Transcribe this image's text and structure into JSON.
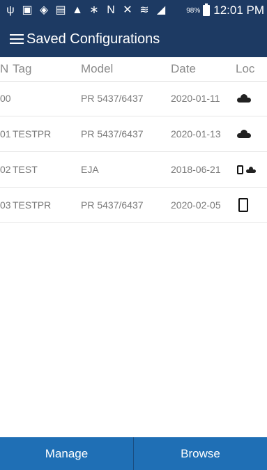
{
  "status_bar": {
    "icons": [
      "usb-icon",
      "image-icon",
      "shield-icon",
      "calendar-icon",
      "warning-icon",
      "bluetooth-icon",
      "nfc-icon",
      "mute-icon",
      "wifi-icon",
      "signal-icon"
    ],
    "battery_percent": "98%",
    "time": "12:01 PM"
  },
  "app_bar": {
    "title": "Saved Configurations"
  },
  "table": {
    "headers": {
      "n": "N",
      "tag": "Tag",
      "model": "Model",
      "date": "Date",
      "loc": "Loc"
    },
    "rows": [
      {
        "n": "00",
        "tag": "",
        "model": "PR 5437/6437",
        "date": "2020-01-11",
        "loc": "cloud"
      },
      {
        "n": "01",
        "tag": "TESTPR",
        "model": "PR 5437/6437",
        "date": "2020-01-13",
        "loc": "cloud"
      },
      {
        "n": "02",
        "tag": "TEST",
        "model": "EJA",
        "date": "2018-06-21",
        "loc": "device-and-cloud"
      },
      {
        "n": "03",
        "tag": "TESTPR",
        "model": "PR 5437/6437",
        "date": "2020-02-05",
        "loc": "device"
      }
    ]
  },
  "bottom_bar": {
    "manage_label": "Manage",
    "browse_label": "Browse"
  },
  "colors": {
    "header_bg": "#1d3a63",
    "bottom_bg": "#1f6fb5"
  }
}
